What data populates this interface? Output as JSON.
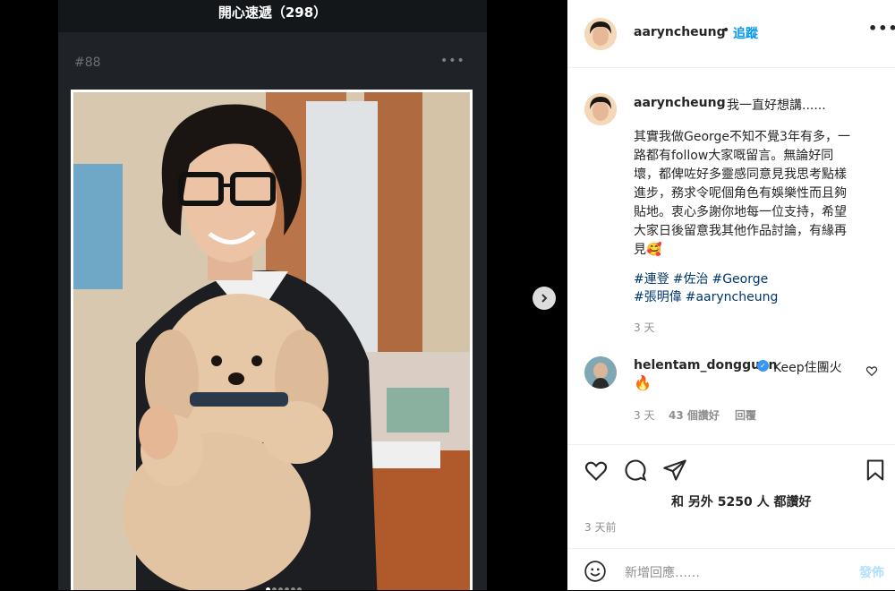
{
  "viewer": {
    "top_bar_title": "開心速遞（298）",
    "post_number": "#88",
    "more_label": "•••",
    "carousel_dots": [
      true,
      false,
      false,
      false,
      false,
      false
    ]
  },
  "header": {
    "username": "aaryncheung",
    "dot": "•",
    "follow_label": "追蹤",
    "more_label": "•••"
  },
  "caption": {
    "username": "aaryncheung",
    "intro": "我一直好想講......",
    "lines": [
      "其實我做George不知不覺3年有多，一",
      "路都有follow大家嘅留言。無論好同",
      "壞，都俾咗好多靈感同意見我思考點樣",
      "進步，務求令呢個角色有娛樂性而且夠",
      "貼地。衷心多謝你地每一位支持，希望",
      "大家日後留意我其他作品討論，有緣再",
      "見🥰"
    ],
    "hashtags_line1": [
      "#連登",
      "#佐治",
      "#George"
    ],
    "hashtags_line2": [
      "#張明偉",
      "#aaryncheung"
    ],
    "age": "3 天"
  },
  "comment": {
    "username": "helentam_dongguan",
    "verified_glyph": "✓",
    "text": "Keep住團火",
    "emoji": "🔥",
    "age": "3 天",
    "likes": "43 個讚好",
    "reply_label": "回覆"
  },
  "actions": {
    "likes_text": "和 另外 5250 人 都讚好",
    "time": "3 天前"
  },
  "comment_box": {
    "placeholder": "新增回應……",
    "post_label": "發佈"
  }
}
